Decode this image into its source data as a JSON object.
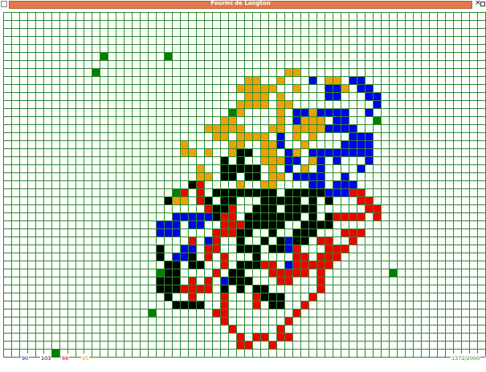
{
  "window": {
    "title": "Fourmi de Langton",
    "icons": {
      "system": "app-menu-icon",
      "close": "close-icon",
      "maximize": "resize-icon"
    },
    "close_label": "×"
  },
  "colors": {
    "grid_line": "#2e8b2e",
    "background": "#ffffff",
    "blue": "#0000f0",
    "black": "#000000",
    "red": "#f00000",
    "orange": "#f0a000",
    "ant": "#008000",
    "title_bar": "#e07a4c"
  },
  "board": {
    "columns": 60,
    "rows": 43
  },
  "status": {
    "count_blue": "90",
    "count_black": "103",
    "count_red": "88",
    "count_orange": "95",
    "steps": "1372/2000"
  },
  "cells": {
    "blue": [
      [
        43,
        8
      ],
      [
        44,
        8
      ],
      [
        38,
        8
      ],
      [
        44,
        9
      ],
      [
        45,
        9
      ],
      [
        40,
        9
      ],
      [
        41,
        9
      ],
      [
        45,
        10
      ],
      [
        46,
        10
      ],
      [
        40,
        10
      ],
      [
        41,
        10
      ],
      [
        46,
        11
      ],
      [
        36,
        12
      ],
      [
        37,
        12
      ],
      [
        39,
        12
      ],
      [
        40,
        12
      ],
      [
        41,
        12
      ],
      [
        42,
        12
      ],
      [
        45,
        12
      ],
      [
        36,
        13
      ],
      [
        41,
        13
      ],
      [
        42,
        13
      ],
      [
        40,
        14
      ],
      [
        41,
        14
      ],
      [
        42,
        14
      ],
      [
        43,
        14
      ],
      [
        34,
        15
      ],
      [
        43,
        15
      ],
      [
        44,
        15
      ],
      [
        45,
        15
      ],
      [
        34,
        16
      ],
      [
        42,
        16
      ],
      [
        43,
        16
      ],
      [
        44,
        16
      ],
      [
        45,
        16
      ],
      [
        35,
        17
      ],
      [
        38,
        17
      ],
      [
        39,
        17
      ],
      [
        40,
        17
      ],
      [
        41,
        17
      ],
      [
        42,
        17
      ],
      [
        43,
        17
      ],
      [
        44,
        17
      ],
      [
        45,
        17
      ],
      [
        35,
        18
      ],
      [
        36,
        18
      ],
      [
        39,
        18
      ],
      [
        41,
        18
      ],
      [
        45,
        18
      ],
      [
        35,
        19
      ],
      [
        39,
        19
      ],
      [
        44,
        19
      ],
      [
        36,
        20
      ],
      [
        37,
        20
      ],
      [
        38,
        20
      ],
      [
        39,
        20
      ],
      [
        42,
        20
      ],
      [
        38,
        21
      ],
      [
        39,
        21
      ],
      [
        41,
        21
      ],
      [
        42,
        21
      ],
      [
        43,
        21
      ],
      [
        40,
        22
      ],
      [
        41,
        22
      ],
      [
        42,
        22
      ],
      [
        21,
        25
      ],
      [
        22,
        25
      ],
      [
        23,
        25
      ],
      [
        24,
        25
      ],
      [
        25,
        25
      ],
      [
        19,
        26
      ],
      [
        20,
        26
      ],
      [
        21,
        26
      ],
      [
        23,
        26
      ],
      [
        24,
        26
      ],
      [
        19,
        27
      ],
      [
        20,
        27
      ],
      [
        21,
        27
      ],
      [
        25,
        28
      ],
      [
        35,
        28
      ],
      [
        22,
        29
      ],
      [
        23,
        29
      ],
      [
        35,
        29
      ],
      [
        21,
        30
      ],
      [
        22,
        30
      ],
      [
        35,
        31
      ],
      [
        27,
        33
      ]
    ],
    "black": [
      [
        29,
        17
      ],
      [
        30,
        17
      ],
      [
        27,
        18
      ],
      [
        29,
        18
      ],
      [
        27,
        19
      ],
      [
        28,
        19
      ],
      [
        29,
        19
      ],
      [
        30,
        19
      ],
      [
        31,
        19
      ],
      [
        27,
        20
      ],
      [
        28,
        20
      ],
      [
        30,
        20
      ],
      [
        31,
        20
      ],
      [
        23,
        21
      ],
      [
        26,
        22
      ],
      [
        27,
        22
      ],
      [
        28,
        22
      ],
      [
        29,
        22
      ],
      [
        30,
        22
      ],
      [
        31,
        22
      ],
      [
        32,
        22
      ],
      [
        33,
        22
      ],
      [
        35,
        22
      ],
      [
        36,
        22
      ],
      [
        37,
        22
      ],
      [
        38,
        22
      ],
      [
        39,
        22
      ],
      [
        40,
        22
      ],
      [
        41,
        22
      ],
      [
        20,
        23
      ],
      [
        25,
        23
      ],
      [
        27,
        23
      ],
      [
        28,
        23
      ],
      [
        32,
        23
      ],
      [
        33,
        23
      ],
      [
        34,
        23
      ],
      [
        35,
        23
      ],
      [
        36,
        23
      ],
      [
        38,
        23
      ],
      [
        40,
        23
      ],
      [
        26,
        24
      ],
      [
        27,
        24
      ],
      [
        31,
        24
      ],
      [
        32,
        24
      ],
      [
        33,
        24
      ],
      [
        35,
        24
      ],
      [
        36,
        24
      ],
      [
        37,
        24
      ],
      [
        38,
        24
      ],
      [
        26,
        25
      ],
      [
        30,
        25
      ],
      [
        31,
        25
      ],
      [
        32,
        25
      ],
      [
        33,
        25
      ],
      [
        34,
        25
      ],
      [
        35,
        25
      ],
      [
        36,
        25
      ],
      [
        38,
        25
      ],
      [
        40,
        25
      ],
      [
        30,
        26
      ],
      [
        31,
        26
      ],
      [
        32,
        26
      ],
      [
        33,
        26
      ],
      [
        34,
        26
      ],
      [
        37,
        26
      ],
      [
        38,
        26
      ],
      [
        39,
        26
      ],
      [
        40,
        26
      ],
      [
        29,
        27
      ],
      [
        30,
        27
      ],
      [
        33,
        27
      ],
      [
        36,
        27
      ],
      [
        37,
        27
      ],
      [
        38,
        27
      ],
      [
        29,
        28
      ],
      [
        32,
        28
      ],
      [
        34,
        28
      ],
      [
        36,
        28
      ],
      [
        37,
        28
      ],
      [
        19,
        29
      ],
      [
        29,
        29
      ],
      [
        30,
        29
      ],
      [
        31,
        29
      ],
      [
        33,
        29
      ],
      [
        34,
        29
      ],
      [
        19,
        30
      ],
      [
        23,
        30
      ],
      [
        31,
        30
      ],
      [
        20,
        31
      ],
      [
        21,
        31
      ],
      [
        23,
        31
      ],
      [
        24,
        31
      ],
      [
        29,
        31
      ],
      [
        30,
        31
      ],
      [
        31,
        31
      ],
      [
        20,
        32
      ],
      [
        21,
        32
      ],
      [
        28,
        32
      ],
      [
        29,
        32
      ],
      [
        19,
        33
      ],
      [
        20,
        33
      ],
      [
        21,
        33
      ],
      [
        28,
        33
      ],
      [
        29,
        33
      ],
      [
        30,
        33
      ],
      [
        19,
        34
      ],
      [
        20,
        34
      ],
      [
        21,
        34
      ],
      [
        27,
        34
      ],
      [
        29,
        34
      ],
      [
        31,
        34
      ],
      [
        32,
        34
      ],
      [
        20,
        35
      ],
      [
        32,
        35
      ],
      [
        33,
        35
      ],
      [
        34,
        35
      ],
      [
        21,
        36
      ],
      [
        22,
        36
      ],
      [
        23,
        36
      ],
      [
        24,
        36
      ],
      [
        33,
        36
      ],
      [
        34,
        36
      ]
    ],
    "red": [
      [
        23,
        21
      ],
      [
        24,
        21
      ],
      [
        22,
        22
      ],
      [
        24,
        22
      ],
      [
        28,
        22
      ],
      [
        43,
        22
      ],
      [
        44,
        22
      ],
      [
        24,
        23
      ],
      [
        44,
        23
      ],
      [
        45,
        23
      ],
      [
        25,
        24
      ],
      [
        27,
        24
      ],
      [
        28,
        24
      ],
      [
        45,
        24
      ],
      [
        46,
        24
      ],
      [
        27,
        25
      ],
      [
        28,
        25
      ],
      [
        41,
        25
      ],
      [
        42,
        25
      ],
      [
        43,
        25
      ],
      [
        44,
        25
      ],
      [
        46,
        25
      ],
      [
        27,
        26
      ],
      [
        28,
        26
      ],
      [
        29,
        26
      ],
      [
        26,
        27
      ],
      [
        27,
        27
      ],
      [
        28,
        27
      ],
      [
        29,
        27
      ],
      [
        42,
        27
      ],
      [
        43,
        27
      ],
      [
        44,
        27
      ],
      [
        23,
        28
      ],
      [
        26,
        28
      ],
      [
        39,
        28
      ],
      [
        40,
        28
      ],
      [
        43,
        28
      ],
      [
        25,
        29
      ],
      [
        26,
        29
      ],
      [
        30,
        29
      ],
      [
        36,
        29
      ],
      [
        40,
        29
      ],
      [
        41,
        29
      ],
      [
        42,
        29
      ],
      [
        25,
        30
      ],
      [
        27,
        30
      ],
      [
        36,
        30
      ],
      [
        37,
        30
      ],
      [
        39,
        30
      ],
      [
        40,
        30
      ],
      [
        41,
        30
      ],
      [
        27,
        31
      ],
      [
        32,
        31
      ],
      [
        33,
        31
      ],
      [
        35,
        31
      ],
      [
        36,
        31
      ],
      [
        37,
        31
      ],
      [
        38,
        31
      ],
      [
        39,
        31
      ],
      [
        40,
        31
      ],
      [
        26,
        32
      ],
      [
        33,
        32
      ],
      [
        34,
        32
      ],
      [
        35,
        32
      ],
      [
        36,
        32
      ],
      [
        37,
        32
      ],
      [
        39,
        32
      ],
      [
        23,
        33
      ],
      [
        25,
        33
      ],
      [
        34,
        33
      ],
      [
        35,
        33
      ],
      [
        39,
        33
      ],
      [
        22,
        34
      ],
      [
        23,
        34
      ],
      [
        24,
        34
      ],
      [
        25,
        34
      ],
      [
        39,
        34
      ],
      [
        23,
        35
      ],
      [
        27,
        35
      ],
      [
        31,
        35
      ],
      [
        32,
        35
      ],
      [
        38,
        35
      ],
      [
        24,
        36
      ],
      [
        27,
        36
      ],
      [
        31,
        36
      ],
      [
        37,
        36
      ],
      [
        26,
        37
      ],
      [
        27,
        37
      ],
      [
        36,
        37
      ],
      [
        27,
        38
      ],
      [
        35,
        38
      ],
      [
        28,
        39
      ],
      [
        34,
        39
      ],
      [
        29,
        40
      ],
      [
        31,
        40
      ],
      [
        32,
        40
      ],
      [
        34,
        40
      ],
      [
        35,
        40
      ],
      [
        29,
        41
      ],
      [
        30,
        41
      ],
      [
        33,
        41
      ]
    ],
    "orange": [
      [
        35,
        7
      ],
      [
        36,
        7
      ],
      [
        30,
        8
      ],
      [
        31,
        8
      ],
      [
        34,
        8
      ],
      [
        40,
        8
      ],
      [
        41,
        8
      ],
      [
        29,
        9
      ],
      [
        30,
        9
      ],
      [
        31,
        9
      ],
      [
        32,
        9
      ],
      [
        33,
        9
      ],
      [
        36,
        9
      ],
      [
        42,
        9
      ],
      [
        30,
        10
      ],
      [
        31,
        10
      ],
      [
        32,
        10
      ],
      [
        34,
        10
      ],
      [
        29,
        11
      ],
      [
        30,
        11
      ],
      [
        31,
        11
      ],
      [
        32,
        11
      ],
      [
        34,
        11
      ],
      [
        35,
        11
      ],
      [
        28,
        12
      ],
      [
        29,
        12
      ],
      [
        34,
        12
      ],
      [
        38,
        12
      ],
      [
        27,
        13
      ],
      [
        28,
        13
      ],
      [
        34,
        13
      ],
      [
        37,
        13
      ],
      [
        38,
        13
      ],
      [
        39,
        13
      ],
      [
        25,
        14
      ],
      [
        26,
        14
      ],
      [
        27,
        14
      ],
      [
        28,
        14
      ],
      [
        29,
        14
      ],
      [
        33,
        14
      ],
      [
        34,
        14
      ],
      [
        36,
        14
      ],
      [
        37,
        14
      ],
      [
        38,
        14
      ],
      [
        39,
        14
      ],
      [
        40,
        14
      ],
      [
        26,
        15
      ],
      [
        27,
        15
      ],
      [
        29,
        15
      ],
      [
        30,
        15
      ],
      [
        31,
        15
      ],
      [
        32,
        15
      ],
      [
        36,
        15
      ],
      [
        38,
        15
      ],
      [
        22,
        16
      ],
      [
        28,
        16
      ],
      [
        29,
        16
      ],
      [
        32,
        16
      ],
      [
        33,
        16
      ],
      [
        34,
        16
      ],
      [
        37,
        16
      ],
      [
        22,
        17
      ],
      [
        23,
        17
      ],
      [
        25,
        17
      ],
      [
        28,
        17
      ],
      [
        32,
        17
      ],
      [
        33,
        17
      ],
      [
        36,
        17
      ],
      [
        32,
        18
      ],
      [
        33,
        18
      ],
      [
        34,
        18
      ],
      [
        35,
        18
      ],
      [
        38,
        18
      ],
      [
        24,
        19
      ],
      [
        31,
        19
      ],
      [
        33,
        19
      ],
      [
        37,
        19
      ],
      [
        24,
        20
      ],
      [
        25,
        20
      ],
      [
        30,
        20
      ],
      [
        31,
        20
      ],
      [
        33,
        20
      ],
      [
        34,
        20
      ],
      [
        23,
        21
      ],
      [
        29,
        21
      ],
      [
        32,
        21
      ],
      [
        33,
        21
      ],
      [
        31,
        22
      ],
      [
        33,
        22
      ],
      [
        26,
        22
      ],
      [
        28,
        22
      ],
      [
        35,
        22
      ],
      [
        37,
        22
      ],
      [
        42,
        22
      ],
      [
        21,
        23
      ],
      [
        22,
        23
      ]
    ],
    "ant": [
      [
        12,
        5
      ],
      [
        20,
        5
      ],
      [
        11,
        7
      ],
      [
        28,
        12
      ],
      [
        46,
        13
      ],
      [
        21,
        22
      ],
      [
        19,
        32
      ],
      [
        48,
        32
      ],
      [
        18,
        37
      ],
      [
        6,
        42
      ]
    ]
  }
}
